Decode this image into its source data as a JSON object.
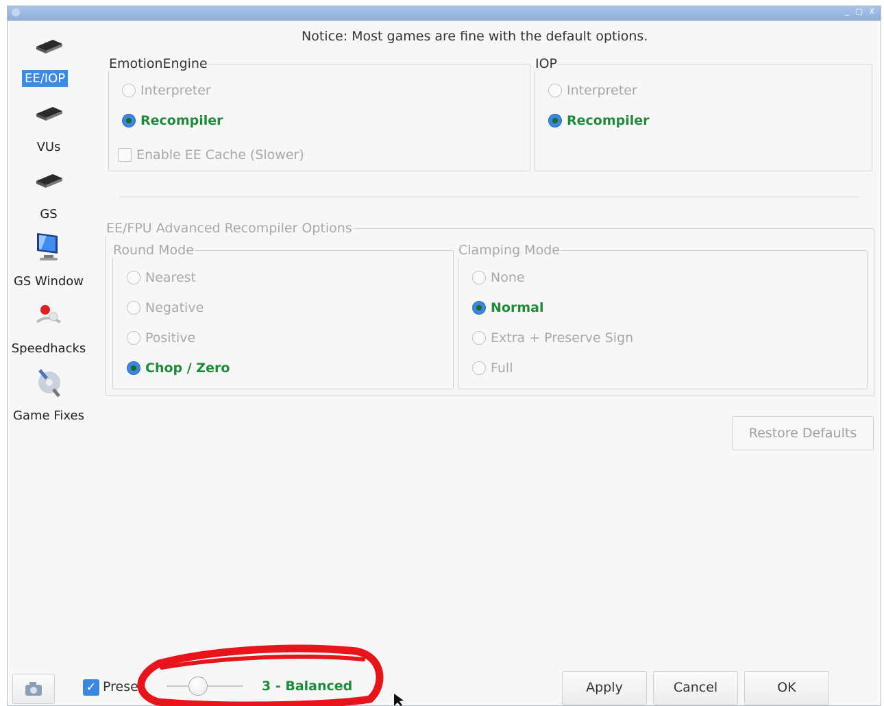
{
  "window": {
    "titlebar_buttons": [
      "_",
      "□",
      "X"
    ]
  },
  "sidebar": {
    "items": [
      {
        "label": "EE/IOP",
        "icon": "chip-icon",
        "selected": true
      },
      {
        "label": "VUs",
        "icon": "chip-icon",
        "selected": false
      },
      {
        "label": "GS",
        "icon": "chip-icon",
        "selected": false
      },
      {
        "label": "GS Window",
        "icon": "monitor-icon",
        "selected": false
      },
      {
        "label": "Speedhacks",
        "icon": "speedhacks-icon",
        "selected": false
      },
      {
        "label": "Game Fixes",
        "icon": "game-fixes-icon",
        "selected": false
      }
    ]
  },
  "notice": "Notice: Most games are fine with the default options.",
  "emotion_engine": {
    "legend": "EmotionEngine",
    "interpreter": "Interpreter",
    "recompiler": "Recompiler",
    "selected": "Recompiler",
    "cache_label": "Enable EE Cache (Slower)",
    "cache_checked": false
  },
  "iop": {
    "legend": "IOP",
    "interpreter": "Interpreter",
    "recompiler": "Recompiler",
    "selected": "Recompiler"
  },
  "advanced": {
    "legend": "EE/FPU Advanced Recompiler Options",
    "round_mode": {
      "legend": "Round Mode",
      "options": [
        "Nearest",
        "Negative",
        "Positive",
        "Chop / Zero"
      ],
      "selected": "Chop / Zero"
    },
    "clamping_mode": {
      "legend": "Clamping Mode",
      "options": [
        "None",
        "Normal",
        "Extra + Preserve Sign",
        "Full"
      ],
      "selected": "Normal"
    }
  },
  "restore_defaults": "Restore Defaults",
  "footer": {
    "presets_label": "Prese",
    "presets_checked": true,
    "preset_value": "3 - Balanced",
    "apply": "Apply",
    "cancel": "Cancel",
    "ok": "OK"
  },
  "colors": {
    "selected_text": "#1f8a3a",
    "selection_bg": "#3c8ce6",
    "annotation": "#e8141c"
  }
}
